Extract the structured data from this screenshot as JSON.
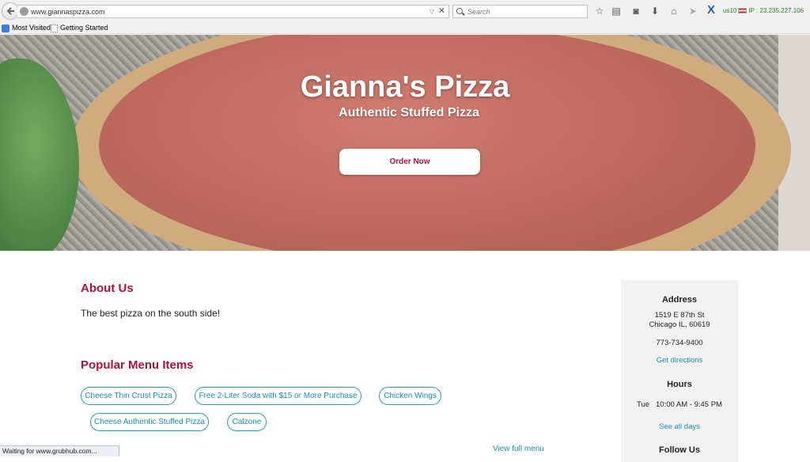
{
  "browser": {
    "url": "www.giannaspizza.com",
    "search_placeholder": "Search",
    "addon": {
      "location": "us10",
      "ip_label": "IP : 23.235.227.106"
    },
    "bookmarks": [
      "Most Visited",
      "Getting Started"
    ],
    "status_text": "Waiting for www.grubhub.com..."
  },
  "hero": {
    "title": "Gianna's Pizza",
    "subtitle": "Authentic Stuffed Pizza",
    "order_button": "Order Now"
  },
  "about": {
    "heading": "About Us",
    "text": "The best pizza on the south side!"
  },
  "menu": {
    "heading": "Popular Menu Items",
    "items": [
      "Cheese Thin Crust Pizza",
      "Free 2-Liter Soda with $15 or More Purchase",
      "Chicken Wings",
      "Cheese Authentic Stuffed Pizza",
      "Calzone"
    ],
    "full_menu_link": "View full menu"
  },
  "sidebar": {
    "address_heading": "Address",
    "address_line1": "1519 E 87th St",
    "address_line2": "Chicago IL, 60619",
    "phone": "773-734-9400",
    "directions_link": "Get directions",
    "hours_heading": "Hours",
    "hours_day": "Tue",
    "hours_time": "10:00 AM - 9:45 PM",
    "all_days_link": "See all days",
    "follow_heading": "Follow Us"
  },
  "colors": {
    "accent_red": "#b0123a",
    "link_blue": "#1a8db3"
  }
}
